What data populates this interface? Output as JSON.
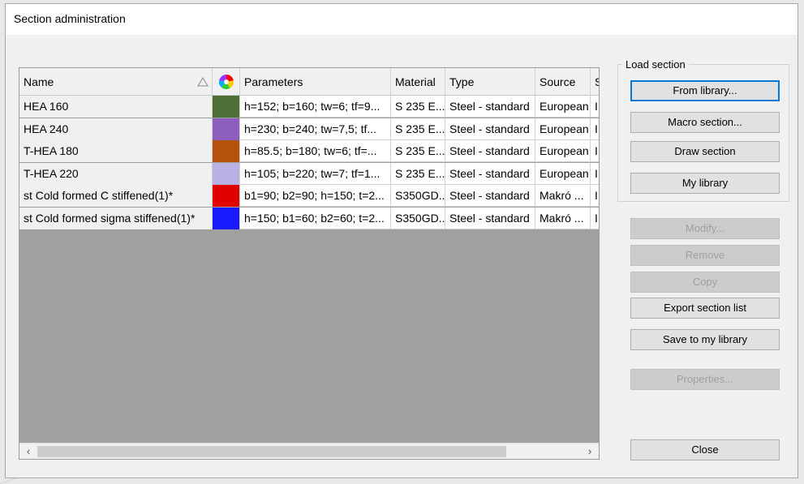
{
  "window": {
    "title": "Section administration"
  },
  "table": {
    "columns": [
      "Name",
      "",
      "Parameters",
      "Material",
      "Type",
      "Source",
      "S"
    ],
    "rows": [
      {
        "name": "HEA 160",
        "color": "#4e6e38",
        "parameters": "h=152; b=160; tw=6; tf=9...",
        "material": "S 235 E...",
        "type": "Steel - standard",
        "source": "European",
        "extra": "I"
      },
      {
        "name": "HEA 240",
        "color": "#8c5fbf",
        "parameters": "h=230; b=240; tw=7,5; tf...",
        "material": "S 235 E...",
        "type": "Steel - standard",
        "source": "European",
        "extra": "I"
      },
      {
        "name": "T-HEA 180",
        "color": "#b45309",
        "parameters": "h=85.5; b=180; tw=6; tf=...",
        "material": "S 235 E...",
        "type": "Steel - standard",
        "source": "European",
        "extra": "I"
      },
      {
        "name": "T-HEA 220",
        "color": "#b9b1e3",
        "parameters": "h=105; b=220; tw=7; tf=1...",
        "material": "S 235 E...",
        "type": "Steel - standard",
        "source": "European",
        "extra": "I"
      },
      {
        "name": "st Cold formed C stiffened(1)*",
        "color": "#e00000",
        "parameters": "b1=90; b2=90; h=150; t=2...",
        "material": "S350GD...",
        "type": "Steel - standard",
        "source": "Makró ...",
        "extra": "I"
      },
      {
        "name": "st Cold formed sigma stiffened(1)*",
        "color": "#1a1aff",
        "parameters": "h=150; b1=60; b2=60; t=2...",
        "material": "S350GD...",
        "type": "Steel - standard",
        "source": "Makró ...",
        "extra": "I"
      }
    ]
  },
  "load_section": {
    "label": "Load section",
    "from_library": "From library...",
    "macro_section": "Macro section...",
    "draw_section": "Draw section",
    "my_library": "My library"
  },
  "actions": {
    "modify": "Modify...",
    "remove": "Remove",
    "copy": "Copy",
    "export": "Export section list",
    "save_to_my_library": "Save to my library",
    "properties": "Properties...",
    "close": "Close"
  },
  "icons": {
    "sort": "sort-ascending-icon",
    "color_column": "color-wheel-icon",
    "scroll_left": "chevron-left-icon",
    "scroll_right": "chevron-right-icon"
  },
  "colors": {
    "accent": "#0078d7",
    "grid_empty": "#a0a0a0"
  }
}
